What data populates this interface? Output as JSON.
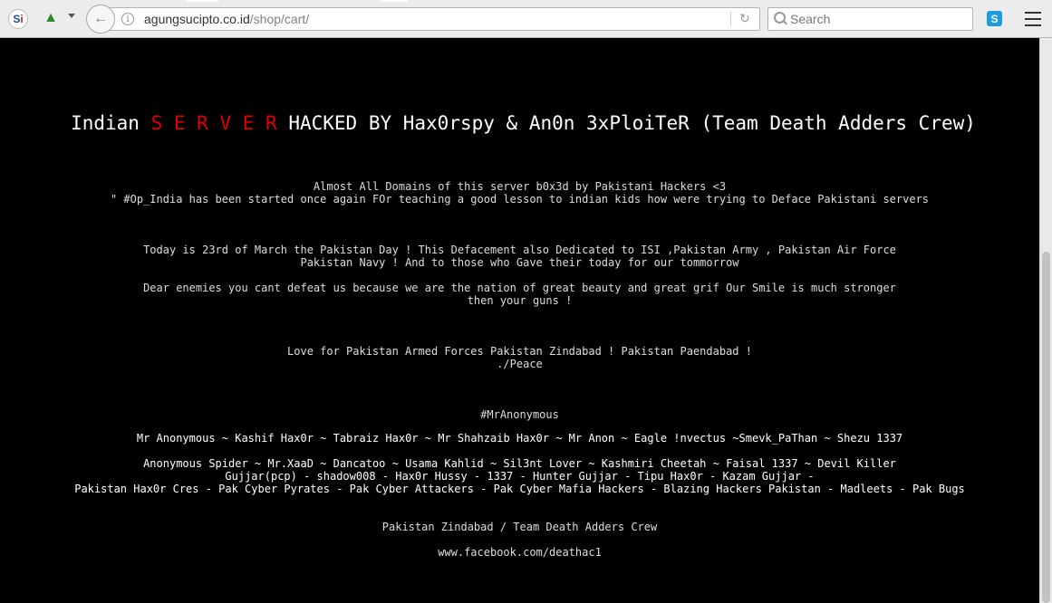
{
  "browser": {
    "url_host": "agungsucipto.co.id",
    "url_path": "/shop/cart/",
    "search_placeholder": "Search",
    "icons": [
      "back-arrow-icon",
      "info-icon",
      "reload-icon",
      "search-icon",
      "skype-icon",
      "menu-icon"
    ]
  },
  "page": {
    "title_prefix": "Indian ",
    "title_red": "S E R V E R",
    "title_suffix": " HACKED BY Hax0rspy & An0n 3xPloiTeR (Team Death Adders Crew)",
    "accent_red": "#e00000",
    "lines": [
      "Almost All Domains of this server b0x3d by Pakistani Hackers <3",
      "\" #Op_India has been started once again FOr teaching a good lesson to indian kids how were trying to Deface Pakistani servers",
      "Today is 23rd of March the Pakistan Day ! This Defacement also Dedicated to ISI ,Pakistan Army , Pakistan Air Force",
      "Pakistan Navy ! And to those who Gave their today for our tommorrow",
      "Dear enemies you cant defeat us because we are the nation of great beauty and great grif Our Smile is much stronger",
      "then your guns !",
      "Love for Pakistan Armed Forces Pakistan Zindabad ! Pakistan Paendabad !",
      "./Peace",
      "#MrAnonymous",
      "Mr Anonymous ~ Kashif Hax0r ~ Tabraiz Hax0r ~ Mr Shahzaib Hax0r ~ Mr Anon ~ Eagle !nvectus ~Smevk_PaThan ~ Shezu 1337",
      "Anonymous Spider ~ Mr.XaaD ~ Dancatoo ~ Usama Kahlid ~ Sil3nt Lover ~ Kashmiri Cheetah ~ Faisal 1337 ~ Devil Killer",
      "Gujjar(pcp) - shadow008 - Hax0r Hussy - 1337 - Hunter Gujjar - Tipu Hax0r - Kazam Gujjar -",
      "Pakistan Hax0r Cres - Pak Cyber Pyrates - Pak Cyber Attackers - Pak Cyber Mafia Hackers - Blazing Hackers Pakistan - Madleets - Pak Bugs",
      "Pakistan Zindabad / Team Death Adders Crew",
      "www.facebook.com/deathac1"
    ]
  }
}
